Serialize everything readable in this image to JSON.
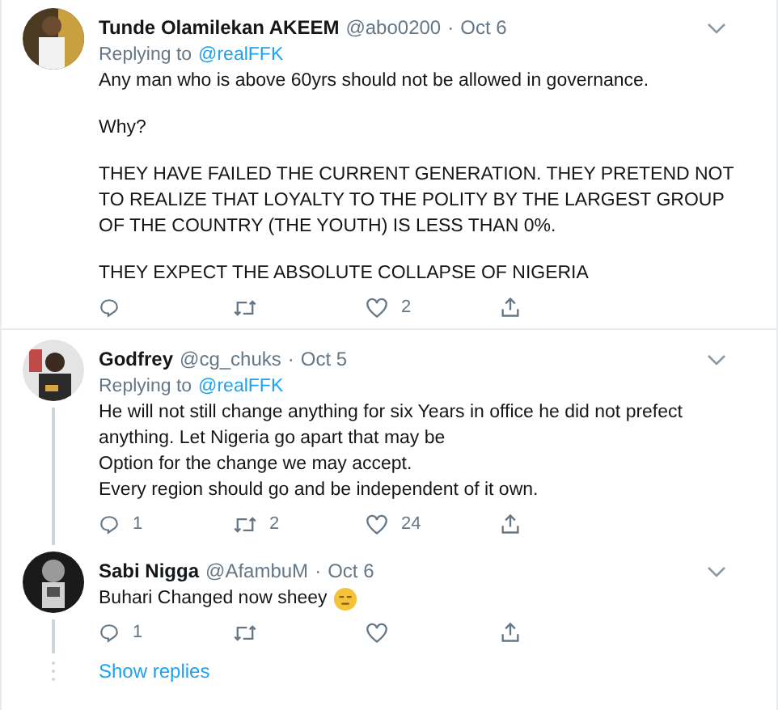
{
  "tweets": [
    {
      "name": "Tunde Olamilekan AKEEM",
      "handle": "@abo0200",
      "separator": "·",
      "date": "Oct 6",
      "replying_label": "Replying to",
      "replying_to": "@realFFK",
      "paragraphs": [
        "Any man who is above 60yrs should not be allowed in governance.",
        "Why?",
        "THEY HAVE FAILED THE CURRENT GENERATION. THEY PRETEND NOT TO REALIZE THAT LOYALTY TO THE POLITY BY THE LARGEST GROUP OF THE COUNTRY (THE YOUTH) IS LESS THAN 0%.",
        "THEY EXPECT THE ABSOLUTE COLLAPSE OF NIGERIA"
      ],
      "emoji": false,
      "thread": false,
      "actions": [
        {
          "kind": "reply"
        },
        {
          "kind": "retweet"
        },
        {
          "kind": "like",
          "count": "2"
        },
        {
          "kind": "share"
        }
      ]
    },
    {
      "name": "Godfrey",
      "handle": "@cg_chuks",
      "separator": "·",
      "date": "Oct 5",
      "replying_label": "Replying to",
      "replying_to": "@realFFK",
      "paragraphs": [
        "He will not still change anything for six Years in office he did not prefect anything. Let Nigeria go apart that may be\nOption for the change we may accept.\nEvery region should go and be independent of it own."
      ],
      "emoji": false,
      "thread": true,
      "actions": [
        {
          "kind": "reply",
          "count": "1"
        },
        {
          "kind": "retweet",
          "count": "2"
        },
        {
          "kind": "like",
          "count": "24"
        },
        {
          "kind": "share"
        }
      ]
    },
    {
      "name": "Sabi Nigga",
      "handle": "@AfambuM",
      "separator": "·",
      "date": "Oct 6",
      "paragraphs": [
        "Buhari Changed now sheey"
      ],
      "emoji": true,
      "thread": true,
      "actions": [
        {
          "kind": "reply",
          "count": "1"
        },
        {
          "kind": "retweet"
        },
        {
          "kind": "like"
        },
        {
          "kind": "share"
        }
      ]
    }
  ],
  "show_replies": "Show replies"
}
